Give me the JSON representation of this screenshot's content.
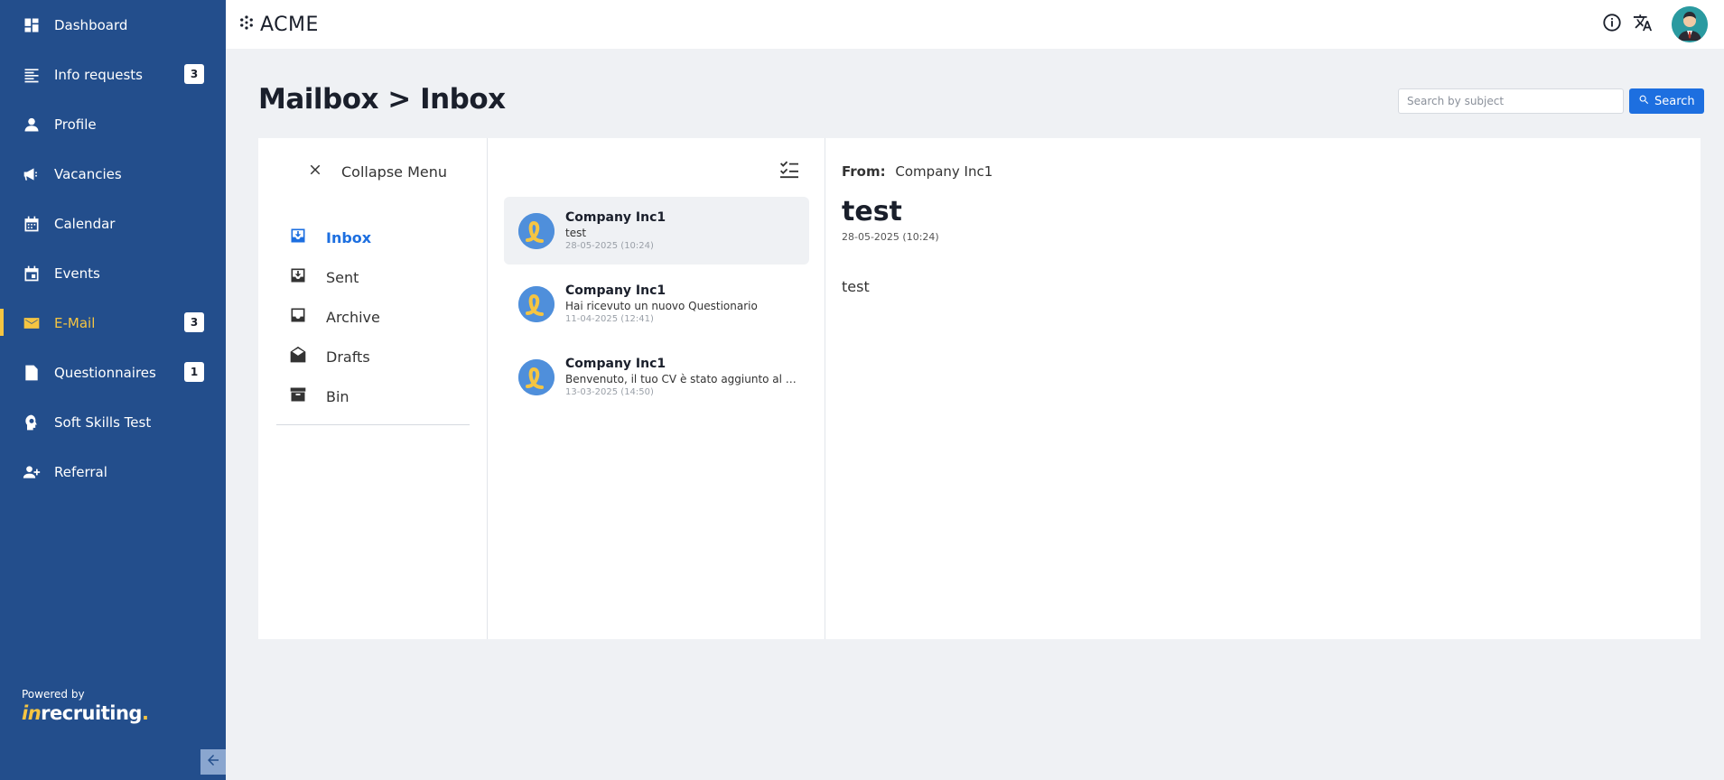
{
  "sidebar": {
    "items": [
      {
        "label": "Dashboard",
        "icon": "dashboard-icon"
      },
      {
        "label": "Info requests",
        "icon": "list-icon",
        "badge": "3"
      },
      {
        "label": "Profile",
        "icon": "person-icon"
      },
      {
        "label": "Vacancies",
        "icon": "megaphone-icon"
      },
      {
        "label": "Calendar",
        "icon": "calendar-icon"
      },
      {
        "label": "Events",
        "icon": "event-icon"
      },
      {
        "label": "E-Mail",
        "icon": "mail-icon",
        "badge": "3",
        "active": true
      },
      {
        "label": "Questionnaires",
        "icon": "document-icon",
        "badge": "1"
      },
      {
        "label": "Soft Skills Test",
        "icon": "head-icon"
      },
      {
        "label": "Referral",
        "icon": "person-add-icon"
      }
    ],
    "powered_by": "Powered by",
    "brand_prefix": "in",
    "brand_name": "recruiting",
    "brand_dot": "."
  },
  "topbar": {
    "brand": "ACME"
  },
  "page": {
    "title": "Mailbox > Inbox",
    "search_placeholder": "Search by subject",
    "search_button": "Search"
  },
  "menu": {
    "collapse_label": "Collapse Menu",
    "folders": [
      {
        "label": "Inbox",
        "active": true
      },
      {
        "label": "Sent"
      },
      {
        "label": "Archive"
      },
      {
        "label": "Drafts"
      },
      {
        "label": "Bin"
      }
    ]
  },
  "messages": [
    {
      "sender": "Company Inc1",
      "subject": "test",
      "date": "28-05-2025 (10:24)",
      "active": true
    },
    {
      "sender": "Company Inc1",
      "subject": "Hai ricevuto un nuovo Questionario",
      "date": "11-04-2025 (12:41)"
    },
    {
      "sender": "Company Inc1",
      "subject": "Benvenuto, il tuo CV è stato aggiunto al …",
      "date": "13-03-2025 (14:50)"
    }
  ],
  "detail": {
    "from_label": "From:",
    "from_value": "Company Inc1",
    "subject": "test",
    "date": "28-05-2025 (10:24)",
    "body": "test"
  },
  "colors": {
    "sidebar": "#234e8c",
    "accent": "#f5c542",
    "primary": "#1d6fe0",
    "background": "#eff1f4"
  }
}
